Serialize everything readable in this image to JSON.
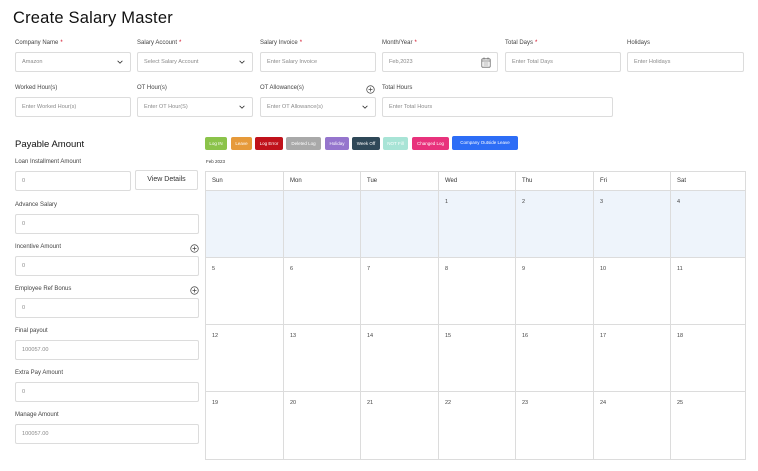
{
  "page": {
    "title": "Create Salary Master"
  },
  "top_fields": {
    "company": {
      "label": "Company Name",
      "value": "Amazon"
    },
    "salary_account": {
      "label": "Salary Account",
      "placeholder": "Select Salary Account"
    },
    "salary_invoice": {
      "label": "Salary Invoice",
      "placeholder": "Enter Salary Invoice"
    },
    "month_year": {
      "label": "Month/Year",
      "value": "Feb,2023"
    },
    "total_days": {
      "label": "Total Days",
      "placeholder": "Enter Total Days"
    },
    "holidays": {
      "label": "Holidays",
      "placeholder": "Enter Holidays"
    },
    "worked_hours": {
      "label": "Worked Hour(s)",
      "placeholder": "Enter Worked Hour(s)"
    },
    "ot_hours": {
      "label": "OT Hour(s)",
      "placeholder": "Enter OT Hour(S)"
    },
    "ot_allowance": {
      "label": "OT Allowance(s)",
      "placeholder": "Enter OT Allowance(s)"
    },
    "total_hours": {
      "label": "Total Hours",
      "placeholder": "Enter Total Hours"
    }
  },
  "payable": {
    "title": "Payable Amount",
    "view_details": "View Details",
    "loan": {
      "label": "Loan Installment Amount",
      "value": "0"
    },
    "advance": {
      "label": "Advance Salary",
      "value": "0"
    },
    "incentive": {
      "label": "Incentive Amount",
      "value": "0"
    },
    "referral": {
      "label": "Employee Ref Bonus",
      "value": "0"
    },
    "final_payout": {
      "label": "Final payout",
      "value": "100057.00"
    },
    "extra_pay": {
      "label": "Extra Pay Amount",
      "value": "0"
    },
    "manage_amount": {
      "label": "Manage Amount",
      "value": "100057.00"
    }
  },
  "legend": [
    {
      "label": "Log IN",
      "color": "#8bc34a"
    },
    {
      "label": "Leave",
      "color": "#e69a3a"
    },
    {
      "label": "Log Error",
      "color": "#c0121b"
    },
    {
      "label": "Deleted Log",
      "color": "#a9a9a9"
    },
    {
      "label": "Holiday",
      "color": "#9575cd"
    },
    {
      "label": "Week Off",
      "color": "#2f4858"
    },
    {
      "label": "NOT Fill",
      "color": "#a8e4d6"
    },
    {
      "label": "Changed Log",
      "color": "#e8327c"
    },
    {
      "label": "Company Outside Leave",
      "color": "#2d6df6"
    }
  ],
  "calendar": {
    "month_label": "Feb 2023",
    "days": [
      "Sun",
      "Mon",
      "Tue",
      "Wed",
      "Thu",
      "Fri",
      "Sat"
    ],
    "weeks": [
      [
        "",
        "",
        "",
        "1",
        "2",
        "3",
        "4"
      ],
      [
        "5",
        "6",
        "7",
        "8",
        "9",
        "10",
        "11"
      ],
      [
        "12",
        "13",
        "14",
        "15",
        "16",
        "17",
        "18"
      ],
      [
        "19",
        "20",
        "21",
        "22",
        "23",
        "24",
        "25"
      ]
    ]
  },
  "icons": {
    "dropdown": "chevron-down-icon",
    "calendar": "calendar-icon",
    "add": "plus-circle-icon"
  }
}
